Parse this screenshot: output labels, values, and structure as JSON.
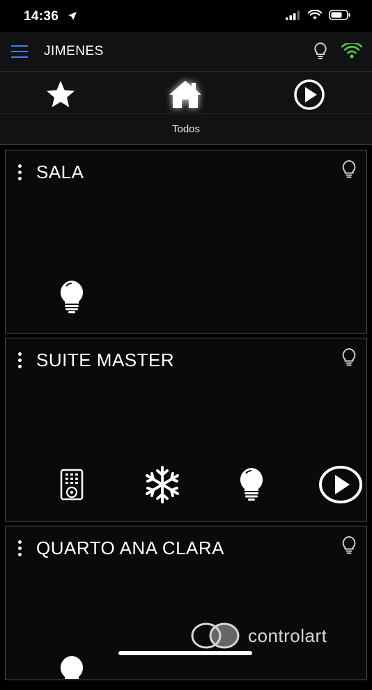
{
  "status_bar": {
    "time": "14:36",
    "icons": [
      "location-arrow-icon",
      "cellular-signal-icon",
      "wifi-icon",
      "battery-icon"
    ]
  },
  "header": {
    "title": "JIMENES",
    "menu_icon": "hamburger-icon",
    "right_icons": [
      "light-bulb-icon",
      "wifi-signal-icon"
    ],
    "wifi_color": "#4cd137",
    "menu_color": "#3b82f6"
  },
  "nav": {
    "tabs": [
      {
        "name": "favorites",
        "icon": "star-icon"
      },
      {
        "name": "home",
        "icon": "home-icon",
        "active": true
      },
      {
        "name": "scenes",
        "icon": "play-circle-icon"
      }
    ],
    "caption": "Todos"
  },
  "rooms": [
    {
      "title": "SALA",
      "devices": [
        "light-bulb-icon"
      ]
    },
    {
      "title": "SUITE MASTER",
      "devices": [
        "remote-control-icon",
        "snowflake-icon",
        "light-bulb-icon",
        "play-circle-icon"
      ]
    },
    {
      "title": "QUARTO ANA CLARA",
      "devices": [
        "light-bulb-icon"
      ]
    }
  ],
  "footer": {
    "brand": "controlart"
  }
}
